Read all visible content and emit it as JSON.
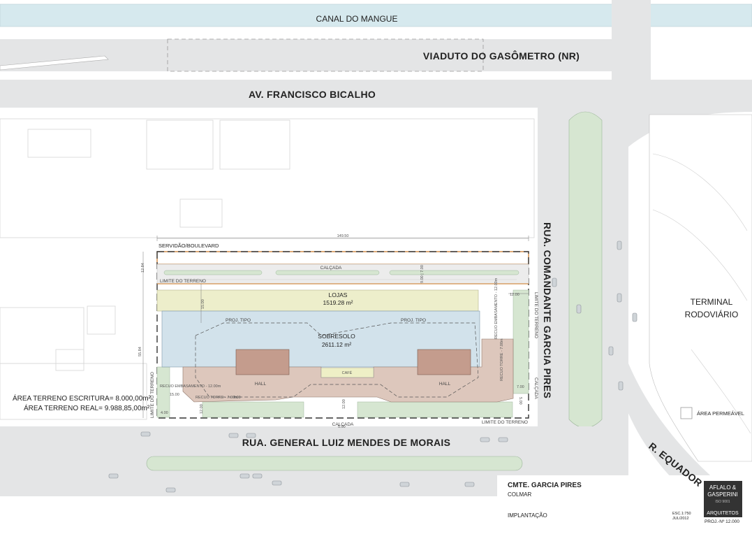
{
  "streets": {
    "canal": "CANAL DO MANGUE",
    "viaduct": "VIADUTO DO GASÔMETRO (NR)",
    "avenue": "AV. FRANCISCO BICALHO",
    "rua_garcia": "RUA. COMANDANTE GARCIA PIRES",
    "rua_general": "RUA. GENERAL LUIZ MENDES DE MORAIS",
    "r_equador": "R. EQUADOR"
  },
  "terminal": {
    "line1": "TERMINAL",
    "line2": "RODOVIÁRIO"
  },
  "site": {
    "servidao": "SERVIDÃO/BOULEVARD",
    "calcada_top": "CALÇADA",
    "calcada_bottom": "CALÇADA",
    "calcada_right": "CALÇADA",
    "limite_top": "LIMITE DO TERRENO",
    "limite_bottom": "LIMITE DO TERRENO",
    "limite_left": "LIMITE DO TERRENO",
    "limite_right": "LIMITE DO TERRENO",
    "lojas": "LOJAS",
    "lojas_area": "1519.28 m²",
    "sobresolo": "SOBRESOLO",
    "sobresolo_area": "2611.12 m²",
    "proj_tipo_1": "PROJ. TIPO",
    "proj_tipo_2": "PROJ. TIPO",
    "hall_1": "HALL",
    "hall_2": "HALL",
    "cafe": "CAFÉ",
    "recuo_embas": "RECUO EMBASAMENTO - 12.00m",
    "recuo_torre": "RECUO TORRE - 7.00m",
    "recuo_embas_right": "RECUO EMBASAMENTO - 12.00m",
    "recuo_torre_right": "RECUO TORRE - 7.00m"
  },
  "dimensions": {
    "width": "149.50",
    "depth": "55.84",
    "top_left": "12.84",
    "d15_top": "15.00",
    "d12_right": "12.00",
    "d15_left": "15.00",
    "d7_left": "7.00",
    "d12_bottom": "12.00",
    "d7_right": "7.00",
    "d5_right": "5.00",
    "d4_left": "4.00",
    "d12_left": "12.00",
    "d5_calcada": "5.00",
    "d9_top": "9.00 | 7.00"
  },
  "areas": {
    "escritura": "ÁREA TERRENO ESCRITURA= 8.000,00m²",
    "real": "ÁREA TERRENO REAL= 9.988,85,00m²"
  },
  "legend": {
    "permeavel": "ÁREA PERMEÁVEL"
  },
  "title_block": {
    "project": "CMTE. GARCIA PIRES",
    "client": "COLMAR",
    "drawing": "IMPLANTAÇÃO",
    "scale": "ESC.1:750",
    "date": "JUL/2012",
    "firm_line1": "AFLALO &",
    "firm_line2": "GASPERINI",
    "firm_line3": "A R Q U I T E T O S",
    "firm_cert": "ISO 9001",
    "firm_role": "ARQUITETOS",
    "proj_num": "PROJ.-Nº 12.000"
  },
  "colors": {
    "canal": "#d6e9ee",
    "road": "#e4e5e6",
    "green": "#d6e6d1",
    "lojas": "#edeecb",
    "sobresolo": "#d2e2eb",
    "hall": "#ddc7bc",
    "tower": "#c49c8d",
    "cafe": "#eeefc6",
    "boundary_orange": "#c8731e"
  }
}
